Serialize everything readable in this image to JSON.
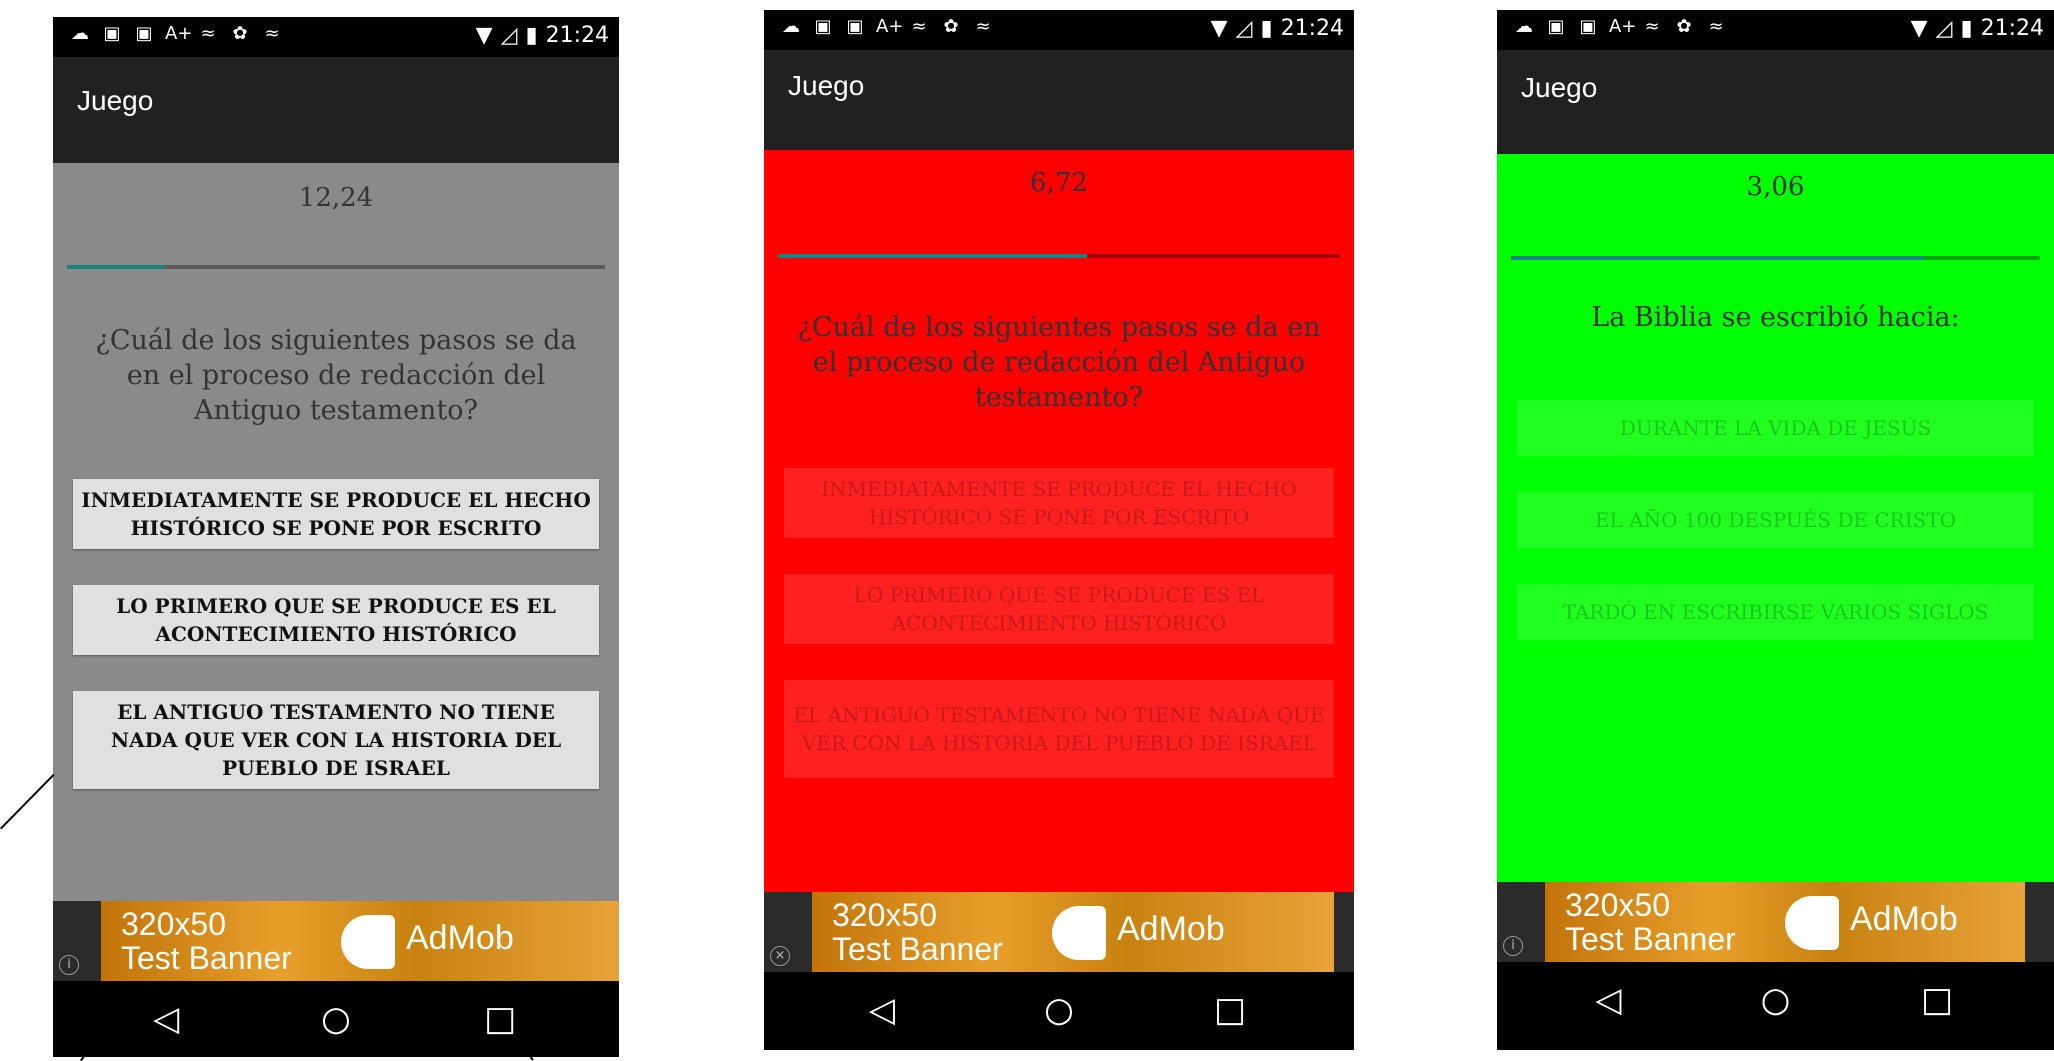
{
  "status_bar": {
    "icons": [
      "weather-icon",
      "gallery-icon",
      "line-app-icon",
      "accessibility-icon",
      "signal-graph-icon",
      "android-icon",
      "signal-graph-icon"
    ],
    "icon_glyphs": [
      "☁",
      "▣",
      "▣",
      "A+",
      "≈",
      "✿",
      "≈"
    ],
    "time": "21:24"
  },
  "screens": [
    {
      "app_title": "Juego",
      "timer": "12,24",
      "progress": 0.18,
      "background": "#8a8a8a",
      "question": "¿Cuál de los siguientes pasos se da en el proceso de redacción del Antiguo testamento?",
      "answers": [
        "INMEDIATAMENTE SE PRODUCE EL HECHO HISTÓRICO SE PONE POR ESCRITO",
        "LO PRIMERO QUE SE PRODUCE ES EL ACONTECIMIENTO HISTÓRICO",
        "EL ANTIGUO TESTAMENTO NO TIENE NADA QUE VER CON LA HISTORIA DEL PUEBLO DE ISRAEL"
      ],
      "answers_enabled": true
    },
    {
      "app_title": "Juego",
      "timer": "6,72",
      "progress": 0.55,
      "background": "#ff0000",
      "question": "¿Cuál de los siguientes pasos se da en el proceso de redacción del Antiguo testamento?",
      "answers": [
        "INMEDIATAMENTE SE PRODUCE EL HECHO HISTÓRICO SE PONE POR ESCRITO",
        "LO PRIMERO QUE SE PRODUCE ES EL ACONTECIMIENTO HISTÓRICO",
        "EL ANTIGUO TESTAMENTO NO TIENE NADA QUE VER CON LA HISTORIA DEL PUEBLO DE ISRAEL"
      ],
      "answers_enabled": false
    },
    {
      "app_title": "Juego",
      "timer": "3,06",
      "progress": 0.78,
      "background": "#00ff00",
      "question": "La Biblia se escribió hacia:",
      "answers": [
        "DURANTE LA VIDA DE JESÚS",
        "EL AÑO 100 DESPUÉS DE CRISTO",
        "TARDÓ EN ESCRIBIRSE VARIOS SIGLOS"
      ],
      "answers_enabled": false
    }
  ],
  "ad_banner": {
    "line1": "320x50",
    "line2": "Test Banner",
    "brand": "AdMob",
    "badges": [
      "info-icon",
      "close-icon",
      "info-icon"
    ],
    "badge_glyphs": [
      "i",
      "×",
      "i"
    ]
  },
  "nav_bar": {
    "back": "◁",
    "home": "○",
    "recents": "□"
  },
  "colors": {
    "progress_fill": "#18837e",
    "app_bar": "#212121",
    "status_bar": "#000000"
  }
}
